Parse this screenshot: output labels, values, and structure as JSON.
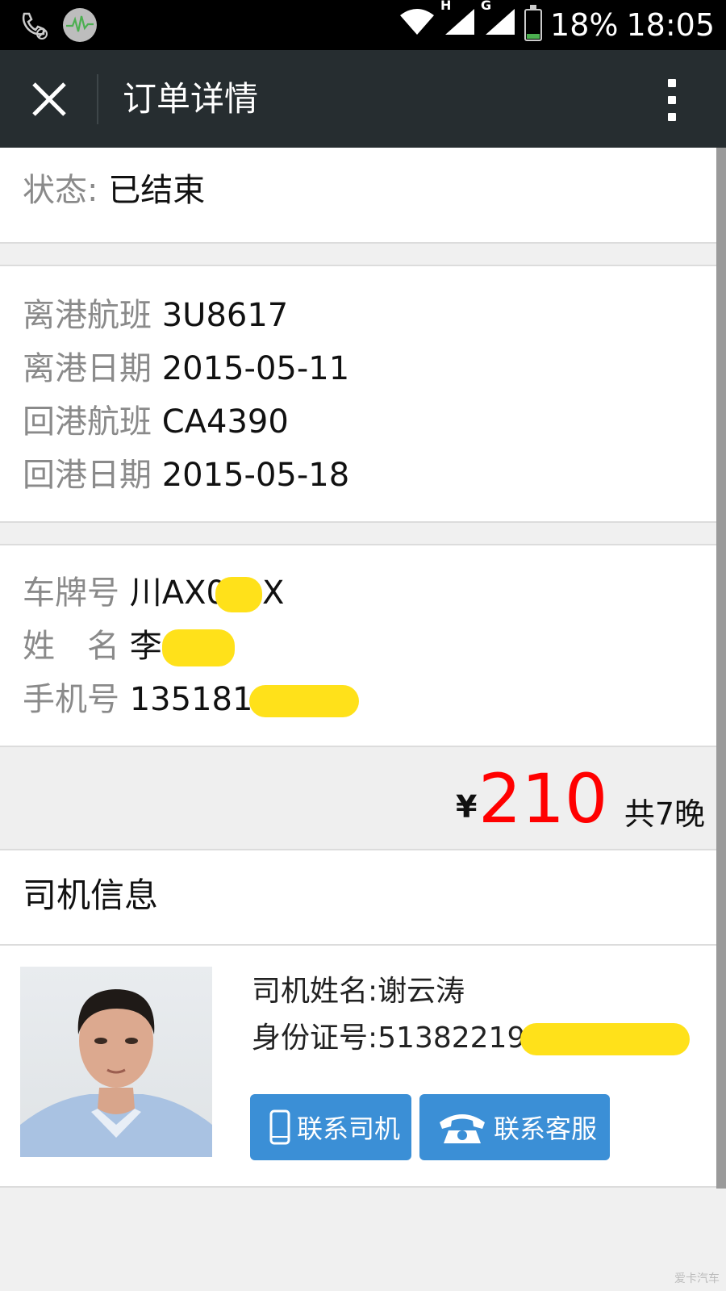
{
  "status_bar": {
    "battery": "18%",
    "time": "18:05",
    "network_labels": [
      "H",
      "G"
    ],
    "battery_level": 0.18,
    "battery_color": "#4caf50"
  },
  "header": {
    "title": "订单详情",
    "close_icon": "close-icon",
    "menu_icon": "more-vertical-icon"
  },
  "order": {
    "status_label": "状态:",
    "status_value": "已结束",
    "departure_flight_label": "离港航班",
    "departure_flight_value": "3U8617",
    "departure_date_label": "离港日期",
    "departure_date_value": "2015-05-11",
    "return_flight_label": "回港航班",
    "return_flight_value": "CA4390",
    "return_date_label": "回港日期",
    "return_date_value": "2015-05-18",
    "plate_label": "车牌号",
    "plate_value_start": "川AX0",
    "plate_value_end": "X",
    "name_label": "姓　名",
    "name_value": "李",
    "phone_label": "手机号",
    "phone_value": "135181"
  },
  "price": {
    "currency": "¥",
    "amount": "210",
    "nights": "共7晚",
    "amount_color": "#ff0000"
  },
  "driver": {
    "section_title": "司机信息",
    "name_line": "司机姓名:谢云涛",
    "id_line": "身份证号:51382219",
    "contact_driver_label": "联系司机",
    "contact_service_label": "联系客服",
    "button_color": "#3b8fd6"
  },
  "watermark": "爱卡汽车"
}
